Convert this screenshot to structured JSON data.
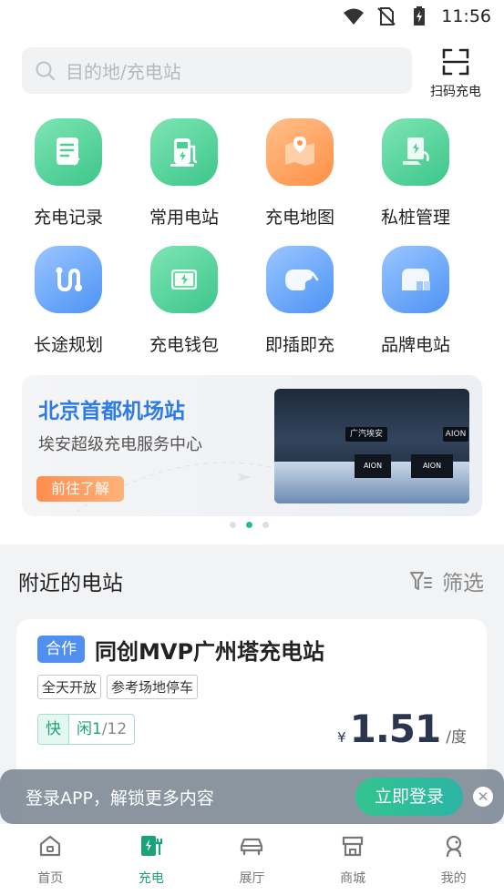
{
  "status_bar": {
    "time": "11:56",
    "icons": [
      "wifi-icon",
      "no-sim-icon",
      "battery-charging-icon"
    ]
  },
  "search": {
    "placeholder": "目的地/充电站",
    "icon": "search-icon"
  },
  "scan": {
    "label": "扫码充电",
    "icon": "scan-icon"
  },
  "grid": [
    {
      "label": "充电记录",
      "icon": "record-icon",
      "color": "green"
    },
    {
      "label": "常用电站",
      "icon": "charger-icon",
      "color": "green"
    },
    {
      "label": "充电地图",
      "icon": "map-icon",
      "color": "orange"
    },
    {
      "label": "私桩管理",
      "icon": "private-pile-icon",
      "color": "green"
    },
    {
      "label": "长途规划",
      "icon": "route-icon",
      "color": "blue"
    },
    {
      "label": "充电钱包",
      "icon": "wallet-icon",
      "color": "green"
    },
    {
      "label": "即插即充",
      "icon": "plug-icon",
      "color": "blue"
    },
    {
      "label": "品牌电站",
      "icon": "brand-station-icon",
      "color": "blue"
    }
  ],
  "banner": {
    "title": "北京首都机场站",
    "subtitle": "埃安超级充电服务中心",
    "cta": "前往了解",
    "photo_signs": [
      "广汽埃安",
      "AION",
      "AION",
      "AION"
    ],
    "carousel_total": 3,
    "carousel_active_index": 1
  },
  "nearby": {
    "title": "附近的电站",
    "filter_label": "筛选",
    "station": {
      "badge": "合作",
      "name": "同创MVP广州塔充电站",
      "tags": [
        "全天开放",
        "参考场地停车"
      ],
      "fast_label": "快",
      "idle_label": "闲1",
      "total": "/12",
      "currency": "¥",
      "price": "1.51",
      "unit": "/度"
    }
  },
  "toast": {
    "message": "登录APP，解锁更多内容",
    "button": "立即登录"
  },
  "tabs": [
    {
      "label": "首页",
      "icon": "home-icon",
      "active": false
    },
    {
      "label": "充电",
      "icon": "charge-icon",
      "active": true
    },
    {
      "label": "展厅",
      "icon": "car-icon",
      "active": false
    },
    {
      "label": "商城",
      "icon": "store-icon",
      "active": false
    },
    {
      "label": "我的",
      "icon": "profile-icon",
      "active": false
    }
  ],
  "colors": {
    "accent_green": "#1aa37a",
    "banner_title": "#2d7be3",
    "price": "#2b3550"
  }
}
